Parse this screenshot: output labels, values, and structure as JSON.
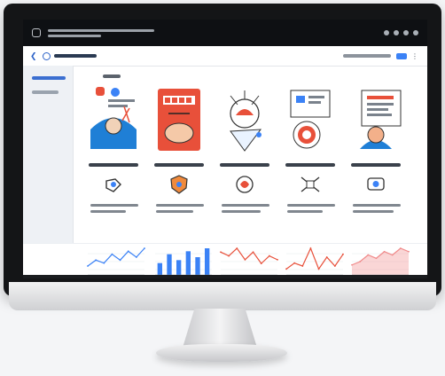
{
  "app": {
    "title": "",
    "subtitle": ""
  },
  "toolbar": {
    "brand_label": "",
    "search_label": "",
    "cta_label": ""
  },
  "sidebar": {
    "items": [
      "",
      ""
    ]
  },
  "section": {
    "title": ""
  },
  "cards": [
    {
      "label": "",
      "description": "",
      "icon": "lightbulb-icon",
      "art": "thinking-person-illustration"
    },
    {
      "label": "",
      "description": "",
      "icon": "shield-heart-icon",
      "art": "stamp-document-illustration"
    },
    {
      "label": "",
      "description": "",
      "icon": "brain-icon",
      "art": "idea-bulb-illustration"
    },
    {
      "label": "",
      "description": "",
      "icon": "network-icon",
      "art": "target-document-illustration"
    },
    {
      "label": "",
      "description": "",
      "icon": "money-chat-icon",
      "art": "report-person-illustration"
    }
  ],
  "charts": [
    {
      "type": "line",
      "x": [
        1,
        2,
        3,
        4,
        5,
        6,
        7,
        8
      ],
      "series": [
        {
          "name": "",
          "values": [
            3,
            5,
            4,
            7,
            5,
            8,
            6,
            9
          ]
        }
      ]
    },
    {
      "type": "bar",
      "x": [
        1,
        2,
        3,
        4,
        5,
        6
      ],
      "series": [
        {
          "name": "",
          "values": [
            4,
            7,
            5,
            8,
            6,
            9
          ]
        }
      ]
    },
    {
      "type": "line",
      "x": [
        1,
        2,
        3,
        4,
        5,
        6,
        7,
        8
      ],
      "series": [
        {
          "name": "",
          "values": [
            6,
            5,
            7,
            4,
            6,
            3,
            5,
            4
          ]
        }
      ]
    },
    {
      "type": "line",
      "x": [
        1,
        2,
        3,
        4,
        5,
        6,
        7,
        8
      ],
      "series": [
        {
          "name": "",
          "values": [
            2,
            4,
            3,
            9,
            2,
            6,
            3,
            7
          ]
        }
      ]
    },
    {
      "type": "area",
      "x": [
        1,
        2,
        3,
        4,
        5,
        6,
        7,
        8
      ],
      "series": [
        {
          "name": "",
          "values": [
            3,
            4,
            6,
            5,
            7,
            6,
            8,
            7
          ]
        }
      ]
    }
  ],
  "colors": {
    "accent": "#3b82f6",
    "brand": "#2d63c8",
    "card_red": "#e8503a",
    "topbar": "#0e1013"
  }
}
